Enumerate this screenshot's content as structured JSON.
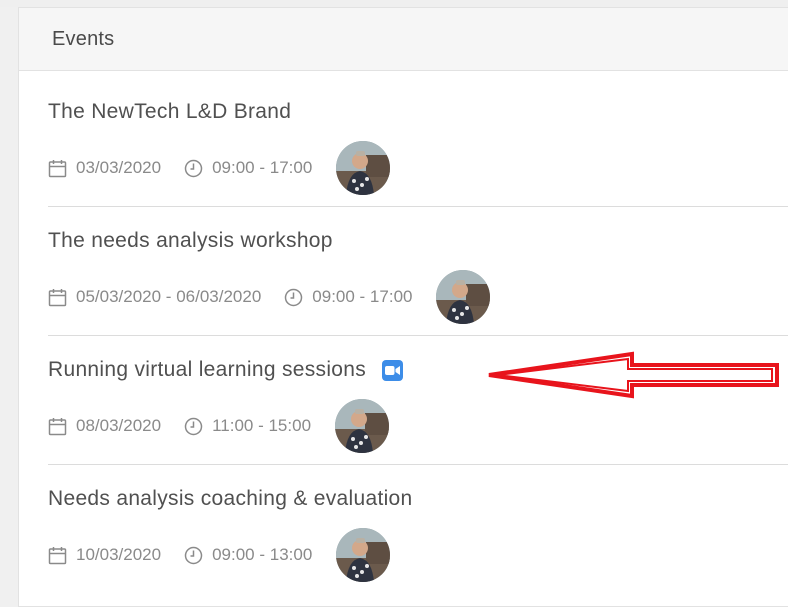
{
  "panel": {
    "title": "Events"
  },
  "events": [
    {
      "title": "The NewTech L&D Brand",
      "date": "03/03/2020",
      "time": "09:00 - 17:00",
      "has_video_badge": false
    },
    {
      "title": "The needs analysis workshop",
      "date": "05/03/2020 - 06/03/2020",
      "time": "09:00 - 17:00",
      "has_video_badge": false
    },
    {
      "title": "Running virtual learning sessions",
      "date": "08/03/2020",
      "time": "11:00 - 15:00",
      "has_video_badge": true
    },
    {
      "title": "Needs analysis coaching & evaluation",
      "date": "10/03/2020",
      "time": "09:00 - 13:00",
      "has_video_badge": false
    }
  ],
  "icons": {
    "date": "calendar-icon",
    "time": "clock-icon",
    "video": "video-camera-icon",
    "annotation": "red-arrow-annotation"
  },
  "colors": {
    "video_badge": "#3d8de8",
    "arrow": "#e8141c",
    "title_text": "#505050",
    "meta_text": "#8a8a8a"
  }
}
